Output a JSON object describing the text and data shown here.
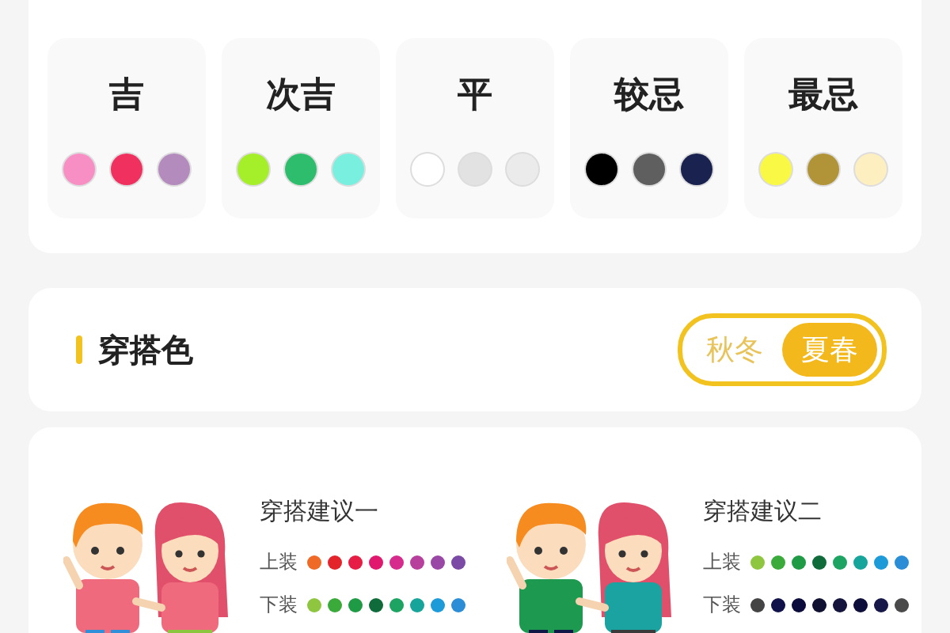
{
  "levels": [
    {
      "label": "吉",
      "dots": [
        {
          "color": "#f78fc4"
        },
        {
          "color": "#f0305f"
        },
        {
          "color": "#b38bbd"
        }
      ]
    },
    {
      "label": "次吉",
      "dots": [
        {
          "color": "#a4ee2a"
        },
        {
          "color": "#2ebd6c"
        },
        {
          "color": "#79f0df"
        }
      ]
    },
    {
      "label": "平",
      "dots": [
        {
          "color": "#ffffff"
        },
        {
          "color": "#e2e2e2"
        },
        {
          "color": "#ebebeb"
        }
      ]
    },
    {
      "label": "较忌",
      "dots": [
        {
          "color": "#000000"
        },
        {
          "color": "#5f5f5f"
        },
        {
          "color": "#1a2350"
        }
      ]
    },
    {
      "label": "最忌",
      "dots": [
        {
          "color": "#f9f945"
        },
        {
          "color": "#b19437"
        },
        {
          "color": "#fdefc0"
        }
      ]
    }
  ],
  "section": {
    "title": "穿搭色",
    "seasons": [
      {
        "label": "秋冬",
        "selected": false
      },
      {
        "label": "夏春",
        "selected": true
      }
    ]
  },
  "suggestions": [
    {
      "title": "穿搭建议一",
      "rows": [
        {
          "label": "上装",
          "dots": [
            {
              "color": "#ee6a26"
            },
            {
              "color": "#e3242b"
            },
            {
              "color": "#e61d44"
            },
            {
              "color": "#e0196f"
            },
            {
              "color": "#d62b8c"
            },
            {
              "color": "#b8409d"
            },
            {
              "color": "#9a48a5"
            },
            {
              "color": "#7b4aa4"
            }
          ]
        },
        {
          "label": "下装",
          "dots": [
            {
              "color": "#8fc640"
            },
            {
              "color": "#3aab3a"
            },
            {
              "color": "#1f9b46"
            },
            {
              "color": "#0f6c3a"
            },
            {
              "color": "#1da462"
            },
            {
              "color": "#16a49b"
            },
            {
              "color": "#1d9ad8"
            },
            {
              "color": "#2b8dd6"
            }
          ]
        }
      ]
    },
    {
      "title": "穿搭建议二",
      "rows": [
        {
          "label": "上装",
          "dots": [
            {
              "color": "#8fc640"
            },
            {
              "color": "#3aab3a"
            },
            {
              "color": "#1f9b46"
            },
            {
              "color": "#0f6c3a"
            },
            {
              "color": "#1da462"
            },
            {
              "color": "#16a49b"
            },
            {
              "color": "#1d9ad8"
            },
            {
              "color": "#2b8dd6"
            }
          ]
        },
        {
          "label": "下装",
          "dots": [
            {
              "color": "#444444"
            },
            {
              "color": "#12124a"
            },
            {
              "color": "#0c0c3c"
            },
            {
              "color": "#101030"
            },
            {
              "color": "#14143c"
            },
            {
              "color": "#0e0e3a"
            },
            {
              "color": "#181848"
            },
            {
              "color": "#4a4a4a"
            }
          ]
        }
      ]
    }
  ]
}
